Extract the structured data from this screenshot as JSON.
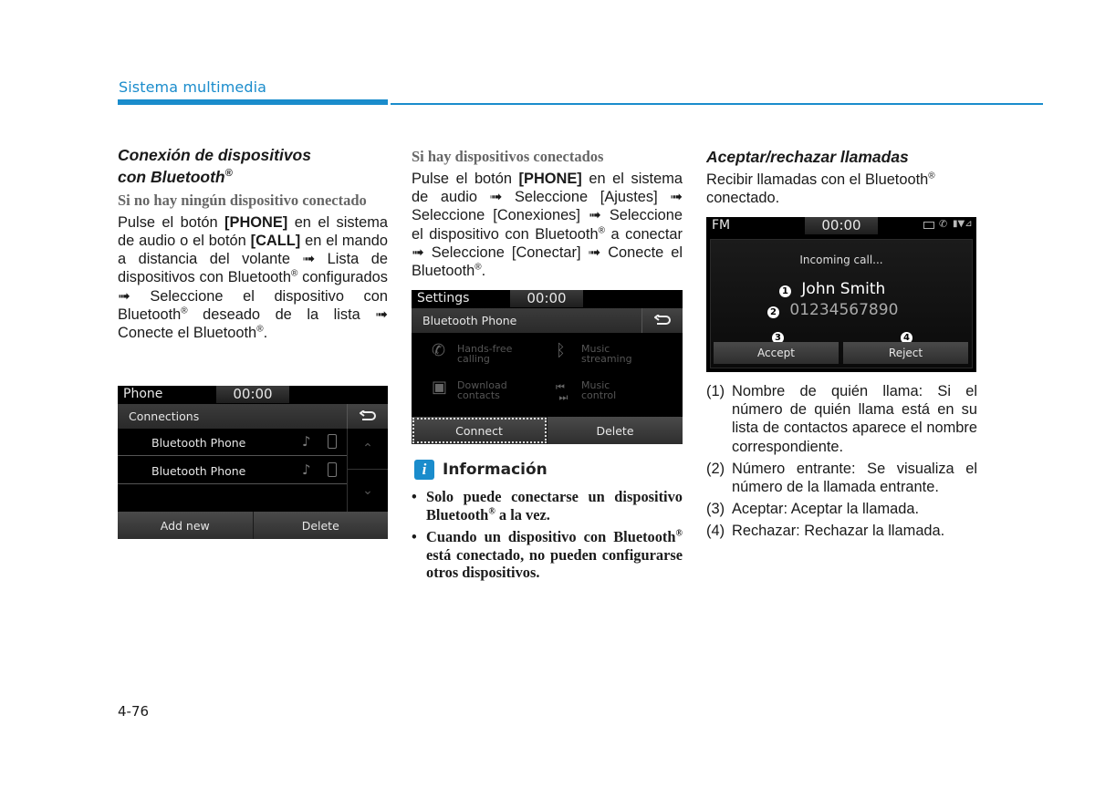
{
  "header": {
    "section_title": "Sistema multimedia",
    "accent_color": "#1a8ccc"
  },
  "col1": {
    "heading_line1": "Conexión de dispositivos",
    "heading_line2": "con Bluetooth",
    "heading_reg": "®",
    "subheading": "Si no hay ningún dispositivo conectado",
    "paragraph_parts": {
      "p1": "Pulse el botón ",
      "b1": "[PHONE]",
      "p2": " en el sistema de audio o el botón ",
      "b2": "[CALL]",
      "p3": " en el mando a distancia del volante ➟ Lista de dispositivos con Bluetooth",
      "p4": " configurados ➟ Seleccione el dispositivo con Bluetooth",
      "p5": " deseado de la lista ➟ Conecte el Bluetooth",
      "p6": "."
    }
  },
  "screen_phone": {
    "app": "Phone",
    "clock": "00:00",
    "title": "Connections",
    "back_icon": "back-arrow-icon",
    "rows": [
      {
        "label": "Bluetooth Phone"
      },
      {
        "label": "Bluetooth Phone"
      }
    ],
    "scroll_up": "⌃",
    "scroll_down": "⌄",
    "buttons": [
      "Add new",
      "Delete"
    ]
  },
  "col2": {
    "subheading": "Si hay dispositivos conectados",
    "paragraph_parts": {
      "p1": "Pulse el botón ",
      "b1": "[PHONE]",
      "p2": " en el sistema de audio ➟ Seleccione [Ajustes] ➟ Seleccione [Conexiones] ➟ Seleccione el dispositivo con Bluetooth",
      "p3": " a conectar ➟ Seleccione [Conectar] ➟ Conecte el Bluetooth",
      "p4": "."
    }
  },
  "screen_settings": {
    "app": "Settings",
    "clock": "00:00",
    "title": "Bluetooth Phone",
    "features": [
      {
        "icon": "handsfree-phone-icon",
        "line1": "Hands-free",
        "line2": "calling"
      },
      {
        "icon": "bluetooth-music-icon",
        "line1": "Music",
        "line2": "streaming"
      },
      {
        "icon": "contacts-icon",
        "line1": "Download",
        "line2": "contacts"
      },
      {
        "icon": "music-control-icon",
        "line1": "Music",
        "line2": "control"
      }
    ],
    "buttons": [
      "Connect",
      "Delete"
    ]
  },
  "info": {
    "title": "Información",
    "bullet1_a": "Solo puede conectarse un dispositivo Bluetooth",
    "bullet1_b": " a la vez.",
    "bullet2_a": "Cuando un dispositivo con Bluetooth",
    "bullet2_b": " está conectado, no pueden configurarse otros dispositivos.",
    "reg": "®"
  },
  "col3": {
    "heading": "Aceptar/rechazar llamadas",
    "intro_a": "Recibir llamadas con el Bluetooth",
    "intro_b": " conectado.",
    "reg": "®",
    "items": [
      {
        "num": "(1)",
        "text": "Nombre de quién llama: Si el número de quién llama está en su lista de contactos aparece el nombre correspondiente."
      },
      {
        "num": "(2)",
        "text": "Número entrante: Se visualiza el número de la llamada entrante."
      },
      {
        "num": "(3)",
        "text": "Aceptar: Aceptar la llamada."
      },
      {
        "num": "(4)",
        "text": "Rechazar: Rechazar la llamada."
      }
    ]
  },
  "screen_call": {
    "app": "FM",
    "clock": "00:00",
    "status_icons": [
      "battery-icon",
      "phone-icon",
      "signal-icon"
    ],
    "incoming": "Incoming call...",
    "caller_name": "John Smith",
    "caller_number": "01234567890",
    "callouts": [
      "1",
      "2",
      "3",
      "4"
    ],
    "buttons": [
      "Accept",
      "Reject"
    ]
  },
  "footer": {
    "page_number": "4-76"
  }
}
